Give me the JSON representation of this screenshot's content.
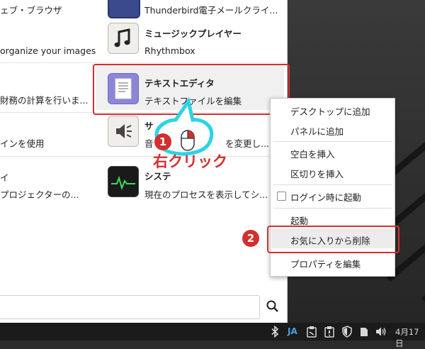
{
  "menu": {
    "left_items": [
      {
        "text": "ェブ・ブラウザ"
      },
      {
        "text": "organize your images"
      },
      {
        "text": "財務の計算を行いま..."
      },
      {
        "text": "インを使用"
      },
      {
        "text": "イ"
      },
      {
        "text": "プロジェクターの..."
      }
    ],
    "apps": [
      {
        "name": "",
        "desc": "Thunderbird電子メールクライ..."
      },
      {
        "name": "ミュージックプレイヤー",
        "desc": "Rhythmbox"
      },
      {
        "name": "テキストエディタ",
        "desc": "テキストファイルを編集"
      },
      {
        "name": "サ",
        "desc": "音"
      },
      {
        "name": "システ",
        "desc": "現在のプロセスを表示してシ..."
      }
    ],
    "partial_texts": {
      "change": "を変更し..."
    }
  },
  "context_menu": {
    "items": [
      "デスクトップに追加",
      "パネルに追加",
      "空白を挿入",
      "区切りを挿入",
      "ログイン時に起動",
      "起動",
      "お気に入りから削除",
      "プロパティを編集"
    ]
  },
  "annotations": {
    "step1": "1",
    "step2": "2",
    "right_click": "右クリック"
  },
  "taskbar": {
    "ime": "JA",
    "date": "4月17日"
  },
  "colors": {
    "accent_red": "#d32f2f",
    "callout_cyan": "#2ad4e6"
  }
}
